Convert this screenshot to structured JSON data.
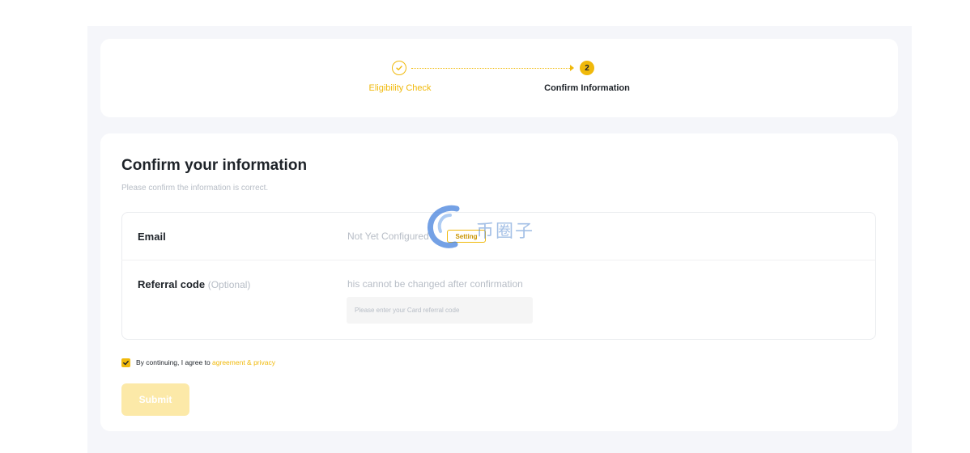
{
  "stepper": {
    "step1_label": "Eligibility Check",
    "step2_number": "2",
    "step2_label": "Confirm Information"
  },
  "form": {
    "title": "Confirm your information",
    "subtitle": "Please confirm the information is correct.",
    "email_label": "Email",
    "email_value": "Not Yet Configured",
    "setting_label": "Setting",
    "referral_label": "Referral code",
    "referral_optional": "(Optional)",
    "referral_note": "his cannot be changed after confirmation",
    "referral_placeholder": "Please enter your Card referral code",
    "referral_value": "",
    "agree_text": "By continuing, I agree to",
    "agree_link": "agreement & privacy",
    "agree_checked": true,
    "submit_label": "Submit"
  },
  "watermark": {
    "text": "币圈子"
  },
  "colors": {
    "accent": "#f0b90b",
    "submit_disabled": "#fce9a8",
    "background": "#f5f6fa",
    "muted_text": "#b7bdc6"
  }
}
